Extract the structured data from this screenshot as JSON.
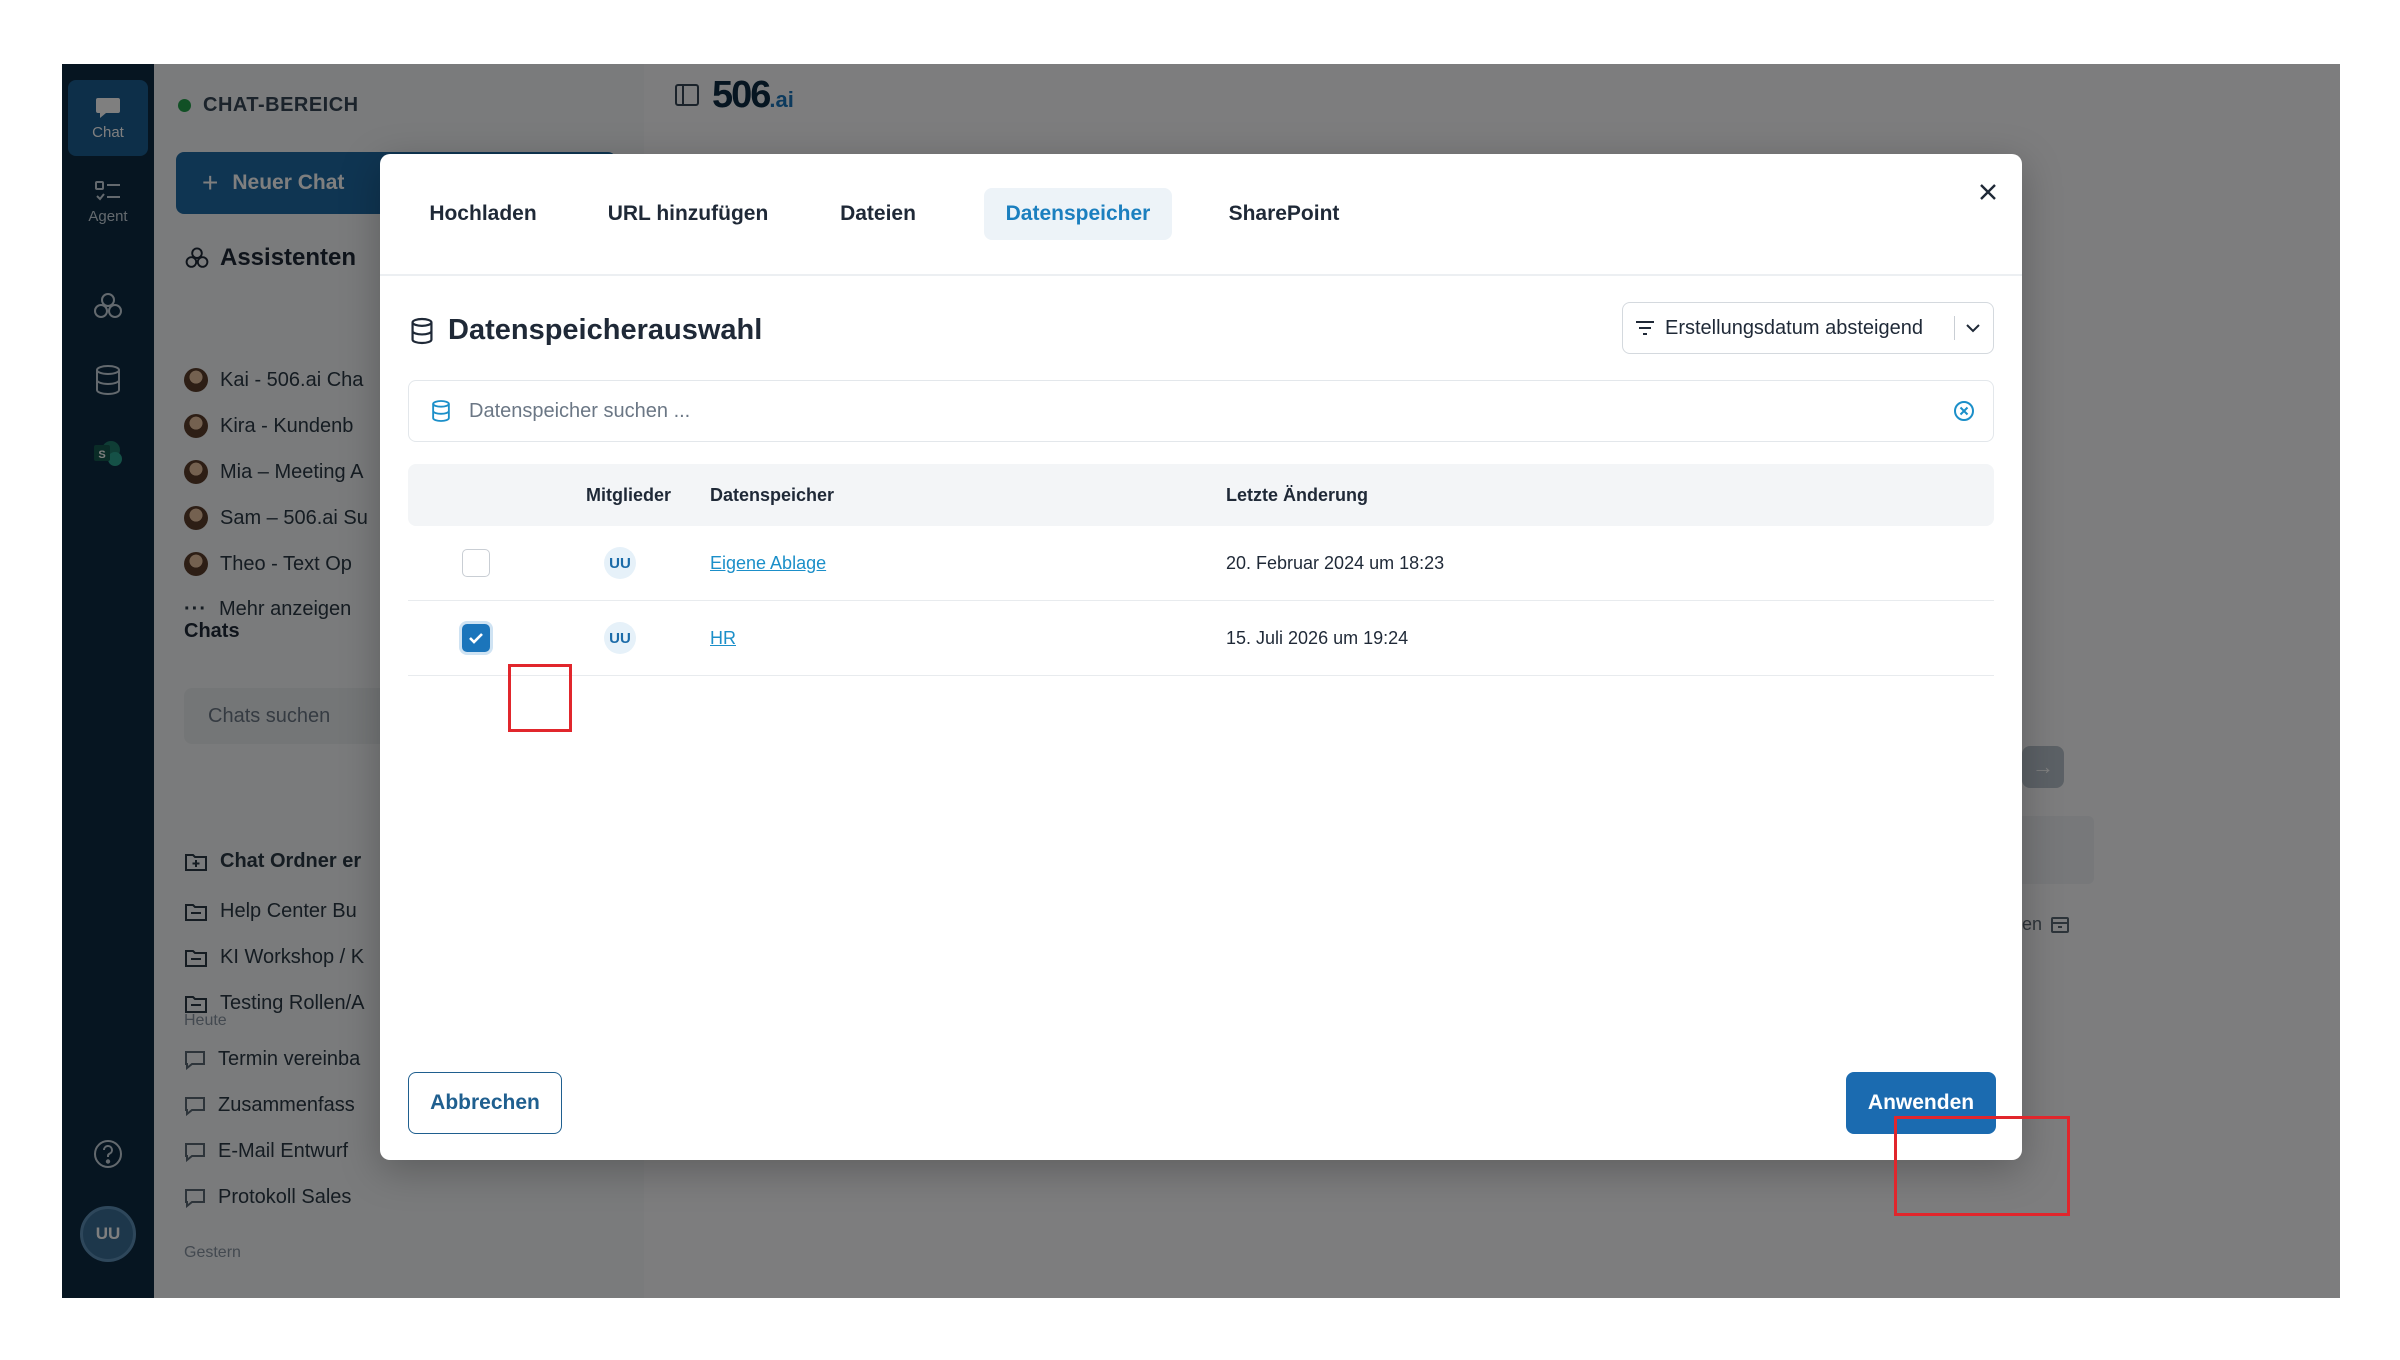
{
  "rail": {
    "chat_label": "Chat",
    "agent_label": "Agent",
    "avatar_initials": "UU"
  },
  "sidebar": {
    "area_title": "CHAT-BEREICH",
    "new_chat_label": "Neuer Chat",
    "assistants_title": "Assistenten",
    "assistants": [
      "Kai - 506.ai Cha",
      "Kira - Kundenb",
      "Mia – Meeting A",
      "Sam – 506.ai Su",
      "Theo - Text Op"
    ],
    "more_label": "Mehr anzeigen",
    "chats_title": "Chats",
    "chats_search_placeholder": "Chats suchen",
    "folders": [
      "Chat Ordner er",
      "Help Center Bu",
      "KI Workshop / K",
      "Testing Rollen/A"
    ],
    "today_label": "Heute",
    "today_chats": [
      "Termin vereinba",
      "Zusammenfass",
      "E-Mail Entwurf",
      "Protokoll Sales"
    ],
    "yesterday_label": "Gestern"
  },
  "main": {
    "logo_text": "506",
    "logo_suffix": ".ai",
    "bottom_text": "nden"
  },
  "modal": {
    "tabs": [
      {
        "label": "Hochladen"
      },
      {
        "label": "URL hinzufügen"
      },
      {
        "label": "Dateien"
      },
      {
        "label": "Datenspeicher"
      },
      {
        "label": "SharePoint"
      }
    ],
    "active_tab": "Datenspeicher",
    "title": "Datenspeicherauswahl",
    "sort_label": "Erstellungsdatum absteigend",
    "search_placeholder": "Datenspeicher suchen ...",
    "columns": {
      "members": "Mitglieder",
      "datastore": "Datenspeicher",
      "modified": "Letzte Änderung"
    },
    "rows": [
      {
        "checked": false,
        "members": "UU",
        "name": "Eigene Ablage",
        "modified": "20. Februar 2024 um 18:23"
      },
      {
        "checked": true,
        "members": "UU",
        "name": "HR",
        "modified": "15. Juli 2026 um 19:24"
      }
    ],
    "cancel_label": "Abbrechen",
    "apply_label": "Anwenden"
  },
  "colors": {
    "accent": "#1b75bb",
    "rail": "#0d2b42",
    "highlight": "#e1262c"
  }
}
